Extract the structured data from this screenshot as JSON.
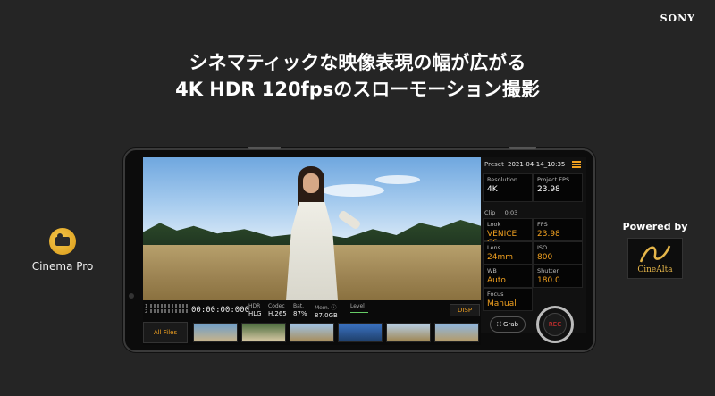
{
  "brand": "SONY",
  "headline": {
    "line1": "シネマティックな映像表現の幅が広がる",
    "line2": "4K HDR 120fpsのスローモーション撮影"
  },
  "left_logo": {
    "icon": "cinema-pro-icon",
    "name": "Cinema Pro"
  },
  "right_logo": {
    "powered_by": "Powered by",
    "logo_text": "CineAlta"
  },
  "app": {
    "preset_label": "Preset",
    "timestamp": "2021-04-14_10:35",
    "clip_label": "Clip",
    "clip_value": "0:03",
    "settings": [
      {
        "label": "Resolution",
        "value": "4K",
        "accent": false
      },
      {
        "label": "Project FPS",
        "value": "23.98",
        "accent": false
      },
      {
        "label": "Look",
        "value": "VENICE CS",
        "accent": true
      },
      {
        "label": "FPS",
        "value": "23.98",
        "accent": true
      },
      {
        "label": "Lens",
        "value": "24mm",
        "accent": true
      },
      {
        "label": "ISO",
        "value": "800",
        "accent": true
      },
      {
        "label": "WB",
        "value": "Auto",
        "accent": true
      },
      {
        "label": "Shutter",
        "value": "180.0",
        "accent": true
      },
      {
        "label": "Focus",
        "value": "Manual",
        "accent": true
      }
    ],
    "meter_labels": [
      "1",
      "2"
    ],
    "timecode": "00:00:00:000",
    "hdr": {
      "label": "HDR",
      "value": "HLG"
    },
    "codec": {
      "label": "Codec",
      "value": "H.265"
    },
    "battery": {
      "label": "Bat.",
      "value": "87%"
    },
    "memory": {
      "label": "Mem. ⓘ",
      "value": "87.0GB"
    },
    "level_label": "Level",
    "disp_label": "DISP",
    "all_files_label": "All Files",
    "grab_label": "Grab",
    "rec_label": "REC",
    "accent_color": "#f0a020"
  }
}
